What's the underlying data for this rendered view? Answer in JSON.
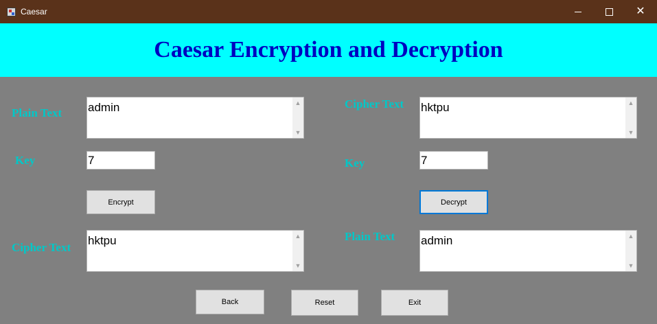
{
  "window": {
    "title": "Caesar",
    "minimize_icon": "minimize-icon",
    "maximize_icon": "maximize-icon",
    "close_icon": "close-icon"
  },
  "header": {
    "title": "Caesar Encryption and Decryption",
    "background": "#00ffff",
    "color": "#0000c0"
  },
  "encrypt_panel": {
    "plain_label": "Plain Text",
    "plain_value": "admin",
    "key_label": "Key",
    "key_value": "7",
    "button_label": "Encrypt",
    "cipher_label": "Cipher Text",
    "cipher_value": "hktpu"
  },
  "decrypt_panel": {
    "cipher_label": "Cipher Text",
    "cipher_value": "hktpu",
    "key_label": "Key",
    "key_value": "7",
    "button_label": "Decrypt",
    "plain_label": "Plain Text",
    "plain_value": "admin"
  },
  "footer": {
    "back_label": "Back",
    "reset_label": "Reset",
    "exit_label": "Exit"
  },
  "colors": {
    "titlebar": "#5a321a",
    "form_background": "#808080",
    "label": "#00c8c8",
    "focus_border": "#0078d7"
  }
}
